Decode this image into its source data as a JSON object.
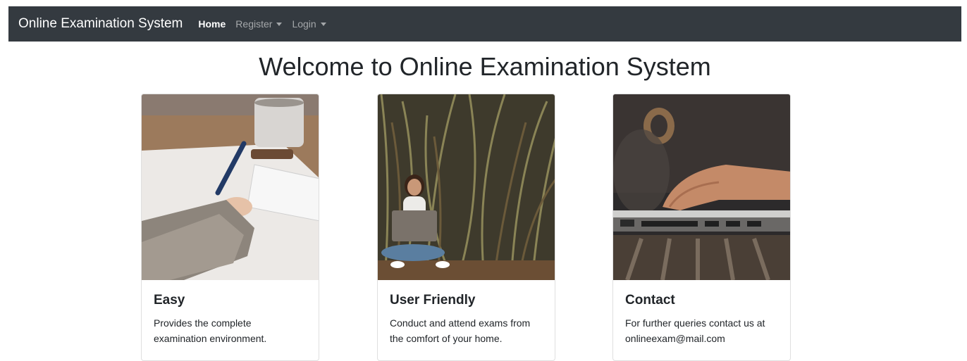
{
  "navbar": {
    "brand": "Online Examination System",
    "links": [
      {
        "label": "Home",
        "active": true,
        "dropdown": false
      },
      {
        "label": "Register",
        "active": false,
        "dropdown": true
      },
      {
        "label": "Login",
        "active": false,
        "dropdown": true
      }
    ]
  },
  "main": {
    "heading": "Welcome to Online Examination System",
    "cards": [
      {
        "title": "Easy",
        "text": "Provides the complete examination environment.",
        "image": "person-writing-with-pen-image"
      },
      {
        "title": "User Friendly",
        "text": "Conduct and attend exams from the comfort of your home.",
        "image": "woman-with-laptop-image"
      },
      {
        "title": "Contact",
        "text": "For further queries contact us at onlineexam@mail.com",
        "image": "hands-typing-laptop-image"
      }
    ]
  },
  "colors": {
    "navbar_bg": "#343a40",
    "text": "#212529"
  }
}
